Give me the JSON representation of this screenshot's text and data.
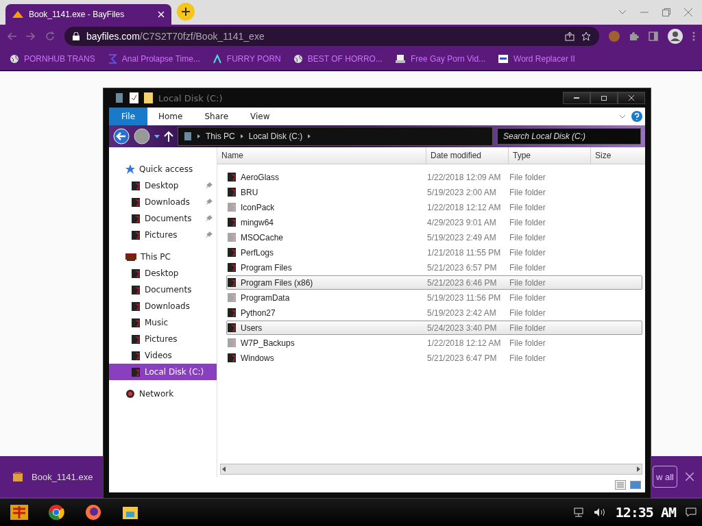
{
  "browser": {
    "tab": {
      "title": "Book_1141.exe - BayFiles"
    },
    "url": {
      "domain": "bayfiles.com",
      "path": "/C7S2T70fzf/Book_1141_exe"
    },
    "bookmarks": [
      {
        "label": "PORNHUB TRANS"
      },
      {
        "label": "Anal Prolapse Time..."
      },
      {
        "label": "FURRY PORN"
      },
      {
        "label": "BEST OF HORRO..."
      },
      {
        "label": "Free Gay Porn Vid..."
      },
      {
        "label": "Word Replacer II"
      }
    ]
  },
  "explorer": {
    "title": "Local Disk (C:)",
    "ribbon_tabs": [
      {
        "label": "File",
        "selected": true
      },
      {
        "label": "Home",
        "selected": false
      },
      {
        "label": "Share",
        "selected": false
      },
      {
        "label": "View",
        "selected": false
      }
    ],
    "breadcrumb": [
      "This PC",
      "Local Disk (C:)"
    ],
    "search": {
      "placeholder": "Search Local Disk (C:)"
    },
    "nav": [
      {
        "label": "Quick access",
        "kind": "star",
        "selected": false,
        "children": [
          {
            "label": "Desktop",
            "pinned": true,
            "selected": false
          },
          {
            "label": "Downloads",
            "pinned": true,
            "selected": false
          },
          {
            "label": "Documents",
            "pinned": true,
            "selected": false
          },
          {
            "label": "Pictures",
            "pinned": true,
            "selected": false
          }
        ]
      },
      {
        "label": "This PC",
        "kind": "pc",
        "selected": false,
        "children": [
          {
            "label": "Desktop",
            "pinned": false,
            "selected": false
          },
          {
            "label": "Documents",
            "pinned": false,
            "selected": false
          },
          {
            "label": "Downloads",
            "pinned": false,
            "selected": false
          },
          {
            "label": "Music",
            "pinned": false,
            "selected": false
          },
          {
            "label": "Pictures",
            "pinned": false,
            "selected": false
          },
          {
            "label": "Videos",
            "pinned": false,
            "selected": false
          },
          {
            "label": "Local Disk (C:)",
            "pinned": false,
            "selected": true
          }
        ]
      },
      {
        "label": "Network",
        "kind": "network",
        "selected": false
      }
    ],
    "columns": [
      "Name",
      "Date modified",
      "Type",
      "Size"
    ],
    "rows": [
      {
        "name": "AeroGlass",
        "date": "1/22/2018 12:09 AM",
        "type": "File folder",
        "hidden": false,
        "selected": false
      },
      {
        "name": "BRU",
        "date": "5/19/2023 2:00 AM",
        "type": "File folder",
        "hidden": false,
        "selected": false
      },
      {
        "name": "IconPack",
        "date": "1/22/2018 12:12 AM",
        "type": "File folder",
        "hidden": true,
        "selected": false
      },
      {
        "name": "mingw64",
        "date": "4/29/2023 9:01 AM",
        "type": "File folder",
        "hidden": false,
        "selected": false
      },
      {
        "name": "MSOCache",
        "date": "5/19/2023 2:49 AM",
        "type": "File folder",
        "hidden": true,
        "selected": false
      },
      {
        "name": "PerfLogs",
        "date": "1/21/2018 11:55 PM",
        "type": "File folder",
        "hidden": false,
        "selected": false
      },
      {
        "name": "Program Files",
        "date": "5/21/2023 6:57 PM",
        "type": "File folder",
        "hidden": false,
        "selected": false
      },
      {
        "name": "Program Files (x86)",
        "date": "5/21/2023 6:46 PM",
        "type": "File folder",
        "hidden": false,
        "selected": true
      },
      {
        "name": "ProgramData",
        "date": "5/19/2023 11:56 PM",
        "type": "File folder",
        "hidden": true,
        "selected": false
      },
      {
        "name": "Python27",
        "date": "5/19/2023 2:42 AM",
        "type": "File folder",
        "hidden": false,
        "selected": false
      },
      {
        "name": "Users",
        "date": "5/24/2023 3:40 PM",
        "type": "File folder",
        "hidden": false,
        "selected": true
      },
      {
        "name": "W7P_Backups",
        "date": "1/22/2018 12:12 AM",
        "type": "File folder",
        "hidden": true,
        "selected": false
      },
      {
        "name": "Windows",
        "date": "5/21/2023 6:47 PM",
        "type": "File folder",
        "hidden": false,
        "selected": false
      }
    ]
  },
  "download_bar": {
    "file": "Book_1141.exe",
    "show_all": "w all"
  },
  "taskbar": {
    "clock": "12:35 AM"
  }
}
